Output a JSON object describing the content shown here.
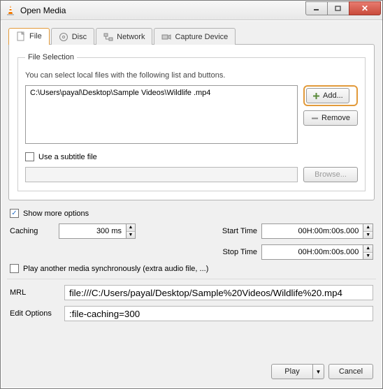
{
  "window": {
    "title": "Open Media"
  },
  "tabs": {
    "file": "File",
    "disc": "Disc",
    "network": "Network",
    "capture": "Capture Device"
  },
  "file_section": {
    "legend": "File Selection",
    "hint": "You can select local files with the following list and buttons.",
    "files": [
      "C:\\Users\\payal\\Desktop\\Sample Videos\\Wildlife .mp4"
    ],
    "add_label": "Add...",
    "remove_label": "Remove",
    "subtitle_check_label": "Use a subtitle file",
    "subtitle_checked": false,
    "browse_label": "Browse..."
  },
  "more_options": {
    "label": "Show more options",
    "checked": true,
    "caching_label": "Caching",
    "caching_value": "300 ms",
    "start_label": "Start Time",
    "start_value": "00H:00m:00s.000",
    "stop_label": "Stop Time",
    "stop_value": "00H:00m:00s.000",
    "sync_label": "Play another media synchronously (extra audio file, ...)",
    "sync_checked": false,
    "mrl_label": "MRL",
    "mrl_value": "file:///C:/Users/payal/Desktop/Sample%20Videos/Wildlife%20.mp4",
    "editopts_label": "Edit Options",
    "editopts_value": ":file-caching=300"
  },
  "footer": {
    "play": "Play",
    "cancel": "Cancel"
  },
  "icons": {
    "file": "file-icon",
    "disc": "disc-icon",
    "network": "network-icon",
    "capture": "capture-icon",
    "plus": "plus-icon",
    "minus": "minus-icon"
  }
}
